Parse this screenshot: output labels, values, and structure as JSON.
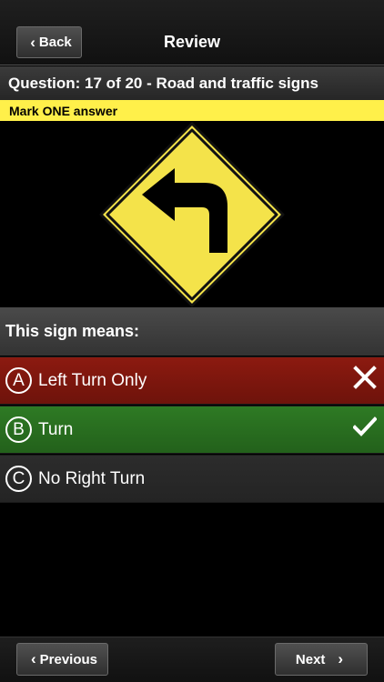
{
  "header": {
    "title": "Review",
    "back_label": "Back"
  },
  "question": {
    "header": "Question: 17 of 20 - Road and traffic signs",
    "instruction": "Mark ONE answer",
    "image_icon": "left-curve-warning-sign",
    "prompt": "This sign means:"
  },
  "answers": [
    {
      "letter": "A",
      "text": "Left Turn Only",
      "status": "incorrect",
      "color": "#8c1a10"
    },
    {
      "letter": "B",
      "text": "Turn",
      "status": "correct",
      "color": "#2e7a24"
    },
    {
      "letter": "C",
      "text": "No Right Turn",
      "status": "neutral",
      "color": "#2c2c2c"
    }
  ],
  "footer": {
    "previous_label": "Previous",
    "next_label": "Next"
  }
}
